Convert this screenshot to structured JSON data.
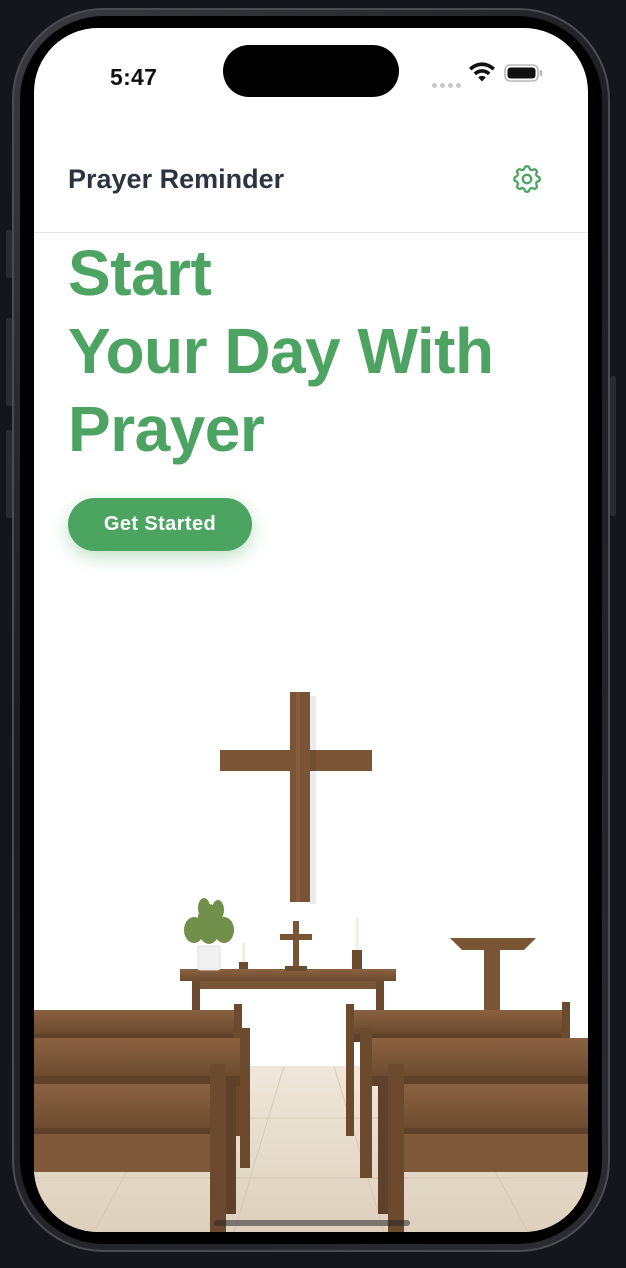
{
  "status_bar": {
    "time": "5:47"
  },
  "nav": {
    "title": "Prayer Reminder",
    "settings_icon": "gear-icon"
  },
  "hero": {
    "line1": "Start",
    "line2": "Your Day With",
    "line3": "Prayer"
  },
  "cta": {
    "label": "Get Started"
  },
  "illustration": {
    "subject": "chapel-interior-image"
  },
  "colors": {
    "accent": "#4CA461",
    "title_text": "#2C3442",
    "wood": "#7A5535",
    "floor": "#E6DCCD"
  }
}
